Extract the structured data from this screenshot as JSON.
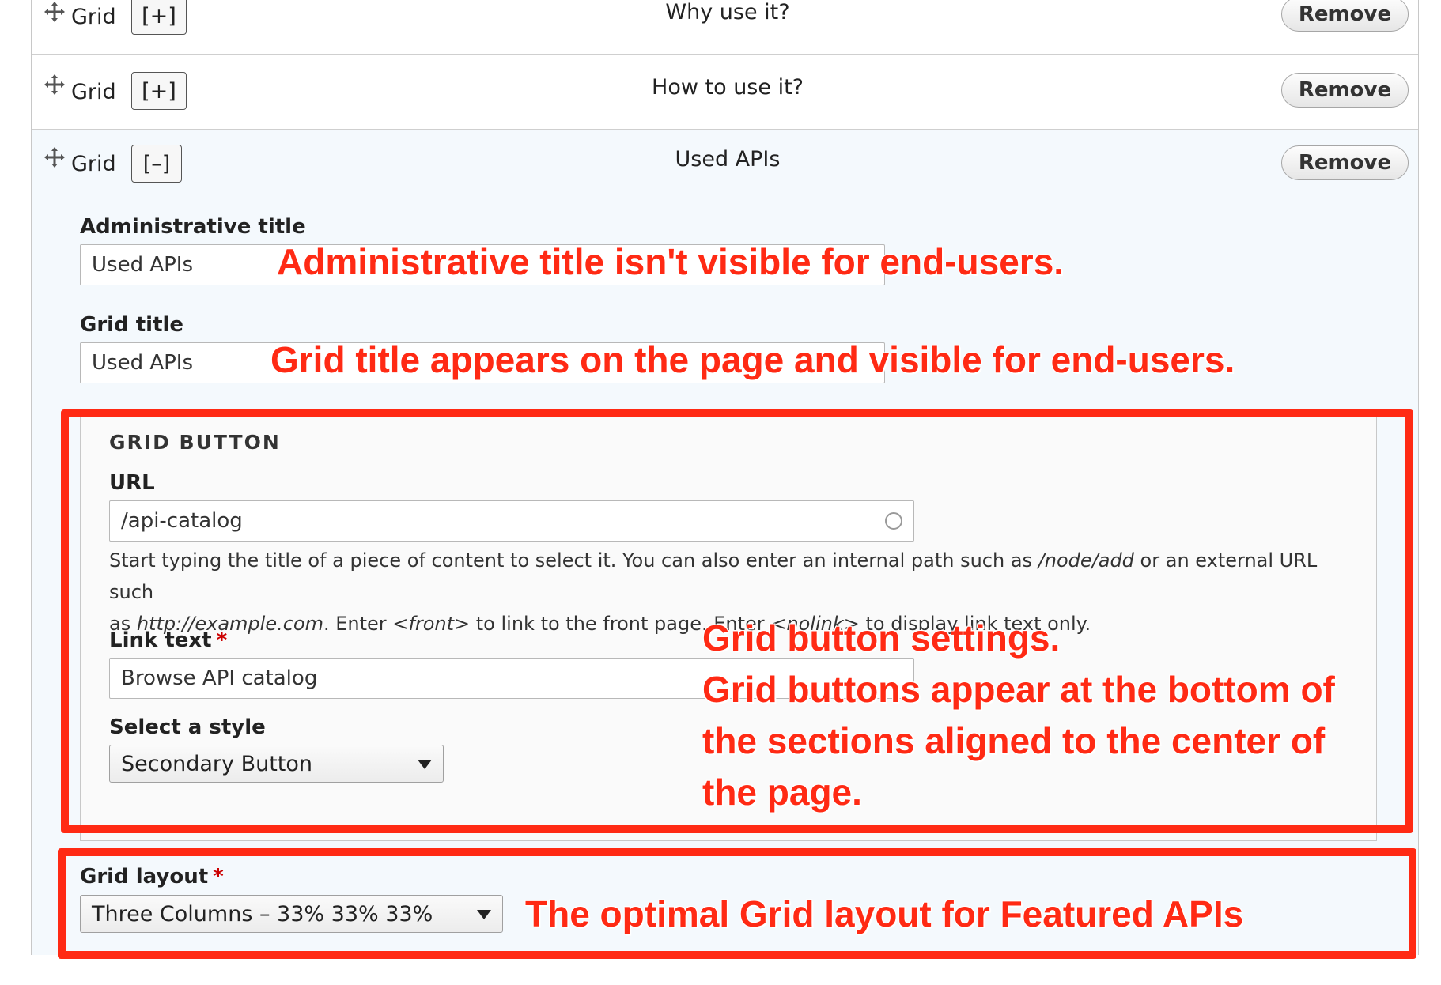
{
  "rows": [
    {
      "label": "Grid",
      "toggle": "[+]",
      "title": "Why use it?",
      "remove": "Remove"
    },
    {
      "label": "Grid",
      "toggle": "[+]",
      "title": "How to use it?",
      "remove": "Remove"
    },
    {
      "label": "Grid",
      "toggle": "[–]",
      "title": "Used APIs",
      "remove": "Remove"
    }
  ],
  "form": {
    "admin_title_label": "Administrative title",
    "admin_title_value": "Used APIs",
    "grid_title_label": "Grid title",
    "grid_title_value": "Used APIs",
    "grid_button": {
      "legend": "GRID BUTTON",
      "url_label": "URL",
      "url_value": "/api-catalog",
      "help_line1_a": "Start typing the title of a piece of content to select it. You can also enter an internal path such as ",
      "help_line1_em": "/node/add",
      "help_line1_b": " or an external URL such",
      "help_line2_a": "as ",
      "help_line2_em1": "http://example.com",
      "help_line2_b": ". Enter ",
      "help_line2_em2": "<front>",
      "help_line2_c": " to link to the front page. Enter ",
      "help_line2_em3": "<nolink>",
      "help_line2_d": " to display link text only.",
      "link_text_label": "Link text",
      "required_mark": "*",
      "link_text_value": "Browse API catalog",
      "style_label": "Select a style",
      "style_value": "Secondary Button"
    },
    "grid_layout_label": "Grid layout",
    "grid_layout_required": "*",
    "grid_layout_value": "Three Columns – 33% 33% 33%"
  },
  "annotations": {
    "admin_title": "Administrative title isn't visible for end-users.",
    "grid_title": "Grid title appears on the page and visible for end-users.",
    "button_line1": "Grid button settings.",
    "button_line2": "Grid buttons appear at the bottom of",
    "button_line3": "the sections aligned to the center of",
    "button_line4": "the page.",
    "layout": "The optimal Grid layout for Featured APIs"
  },
  "colors": {
    "annotation_red": "#ff2a14",
    "expanded_row_bg": "#f4f9fd"
  },
  "icons": {
    "drag": "drag-handle-icon",
    "select_caret": "chevron-down-icon",
    "autocomplete": "autocomplete-throbber-icon"
  }
}
